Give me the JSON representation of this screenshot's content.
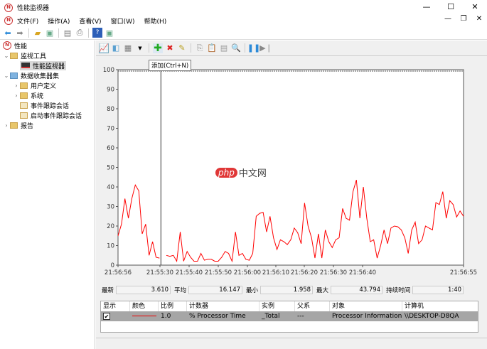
{
  "window": {
    "title": "性能监视器",
    "controls": [
      "—",
      "☐",
      "✕"
    ]
  },
  "menu": [
    "文件(F)",
    "操作(A)",
    "查看(V)",
    "窗口(W)",
    "帮助(H)"
  ],
  "mdi_controls": [
    "—",
    "❐",
    "✕"
  ],
  "tree": {
    "root": "性能",
    "items": [
      {
        "label": "监视工具",
        "level": 1,
        "arrow": "⌄"
      },
      {
        "label": "性能监视器",
        "level": 2,
        "arrow": ""
      },
      {
        "label": "数据收集器集",
        "level": 1,
        "arrow": "⌄"
      },
      {
        "label": "用户定义",
        "level": 2,
        "arrow": "›"
      },
      {
        "label": "系统",
        "level": 2,
        "arrow": "›"
      },
      {
        "label": "事件跟踪会话",
        "level": 2,
        "arrow": ""
      },
      {
        "label": "启动事件跟踪会话",
        "level": 2,
        "arrow": ""
      },
      {
        "label": "报告",
        "level": 1,
        "arrow": "›"
      }
    ]
  },
  "tooltip": "添加(Ctrl+N)",
  "watermark": "php中文网",
  "stats": {
    "last_label": "最新",
    "last": "3.610",
    "avg_label": "平均",
    "avg": "16.147",
    "min_label": "最小",
    "min": "1.958",
    "max_label": "最大",
    "max": "43.794",
    "dur_label": "持续时间",
    "dur": "1:40"
  },
  "table": {
    "headers": [
      "显示",
      "颜色",
      "比例",
      "计数器",
      "实例",
      "父系",
      "对象",
      "计算机"
    ],
    "row": {
      "show": "✔",
      "scale": "1.0",
      "counter": "% Processor Time",
      "instance": "_Total",
      "parent": "---",
      "object": "Processor Information",
      "computer": "\\\\DESKTOP-D8QA"
    }
  },
  "colors": {
    "line": "#ff0000",
    "accent": "#0078d7"
  },
  "chart_data": {
    "type": "line",
    "ylim": [
      0,
      100
    ],
    "yticks": [
      "0",
      "10",
      "20",
      "30",
      "40",
      "50",
      "60",
      "70",
      "80",
      "90",
      "100"
    ],
    "xticks": [
      "21:56:56",
      "21:55:30",
      "21:55:40",
      "21:55:50",
      "21:56:00",
      "21:56:10",
      "21:56:20",
      "21:56:30",
      "21:56:40",
      "21:56:55"
    ],
    "cursor_index": 12,
    "series": [
      {
        "name": "% Processor Time",
        "values": [
          15,
          21,
          34,
          24,
          34,
          41,
          38,
          16,
          21,
          5,
          12,
          4,
          3.6,
          null,
          5,
          4.5,
          5,
          2,
          17,
          2,
          7,
          4,
          2,
          2,
          6,
          2.5,
          3,
          3,
          2,
          2,
          4,
          7,
          6,
          2,
          17,
          5,
          6,
          3,
          2.5,
          6,
          25,
          26.5,
          27,
          17,
          25,
          14,
          8,
          13,
          12,
          10.5,
          13,
          19,
          16.6,
          11,
          31.8,
          20,
          14,
          3.6,
          16,
          3.6,
          18,
          12,
          9,
          13,
          14,
          29,
          24,
          23,
          37.6,
          43.6,
          24,
          40,
          24,
          12,
          13,
          3.6,
          10,
          18,
          11,
          19,
          20,
          19.6,
          18,
          14,
          6,
          18,
          22,
          11,
          13,
          20,
          19,
          18,
          32,
          31,
          37.6,
          24,
          33,
          31,
          24.6,
          27.7,
          25
        ]
      }
    ]
  }
}
